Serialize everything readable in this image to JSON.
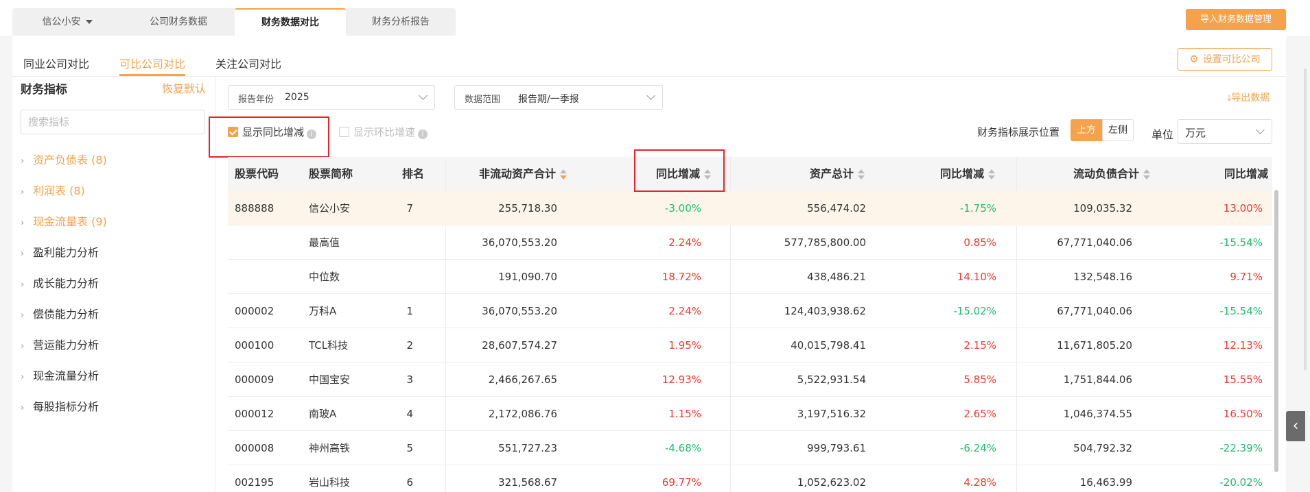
{
  "top_tabs": [
    {
      "label": "信公小安"
    },
    {
      "label": "公司财务数据"
    },
    {
      "label": "财务数据对比"
    },
    {
      "label": "财务分析报告"
    }
  ],
  "import_button": "导入财务数据管理",
  "sub_tabs": [
    {
      "label": "同业公司对比"
    },
    {
      "label": "可比公司对比"
    },
    {
      "label": "关注公司对比"
    }
  ],
  "set_button": "设置可比公司",
  "left_panel": {
    "title": "财务指标",
    "reset": "恢复默认",
    "search_placeholder": "搜索指标",
    "items": [
      {
        "label": "资产负债表 (8)"
      },
      {
        "label": "利润表 (8)"
      },
      {
        "label": "现金流量表 (9)"
      },
      {
        "label": "盈利能力分析"
      },
      {
        "label": "成长能力分析"
      },
      {
        "label": "偿债能力分析"
      },
      {
        "label": "营运能力分析"
      },
      {
        "label": "现金流量分析"
      },
      {
        "label": "每股指标分析"
      }
    ]
  },
  "filters": {
    "year_label": "报告年份",
    "year_value": "2025",
    "range_label": "数据范围",
    "range_value": "报告期/一季报",
    "export": "导出数据",
    "show_yoy": "显示同比增减",
    "show_qoq": "显示环比增速",
    "position_label": "财务指标展示位置",
    "position_top": "上方",
    "position_left": "左侧",
    "unit_label": "单位",
    "unit_value": "万元"
  },
  "table": {
    "headers": [
      "股票代码",
      "股票简称",
      "排名",
      "非流动资产合计",
      "同比增减",
      "资产总计",
      "同比增减",
      "流动负债合计",
      "同比增减"
    ],
    "rows": [
      {
        "code": "888888",
        "name": "信公小安",
        "rank": "7",
        "nca": "255,718.30",
        "nca_yoy": "-3.00%",
        "ta": "556,474.02",
        "ta_yoy": "-1.75%",
        "cl": "109,035.32",
        "cl_yoy": "13.00%"
      },
      {
        "code": "",
        "name": "最高值",
        "rank": "",
        "nca": "36,070,553.20",
        "nca_yoy": "2.24%",
        "ta": "577,785,800.00",
        "ta_yoy": "0.85%",
        "cl": "67,771,040.06",
        "cl_yoy": "-15.54%"
      },
      {
        "code": "",
        "name": "中位数",
        "rank": "",
        "nca": "191,090.70",
        "nca_yoy": "18.72%",
        "ta": "438,486.21",
        "ta_yoy": "14.10%",
        "cl": "132,548.16",
        "cl_yoy": "9.71%"
      },
      {
        "code": "000002",
        "name": "万科A",
        "rank": "1",
        "nca": "36,070,553.20",
        "nca_yoy": "2.24%",
        "ta": "124,403,938.62",
        "ta_yoy": "-15.02%",
        "cl": "67,771,040.06",
        "cl_yoy": "-15.54%"
      },
      {
        "code": "000100",
        "name": "TCL科技",
        "rank": "2",
        "nca": "28,607,574.27",
        "nca_yoy": "1.95%",
        "ta": "40,015,798.41",
        "ta_yoy": "2.15%",
        "cl": "11,671,805.20",
        "cl_yoy": "12.13%"
      },
      {
        "code": "000009",
        "name": "中国宝安",
        "rank": "3",
        "nca": "2,466,267.65",
        "nca_yoy": "12.93%",
        "ta": "5,522,931.54",
        "ta_yoy": "5.85%",
        "cl": "1,751,844.06",
        "cl_yoy": "15.55%"
      },
      {
        "code": "000012",
        "name": "南玻A",
        "rank": "4",
        "nca": "2,172,086.76",
        "nca_yoy": "1.15%",
        "ta": "3,197,516.32",
        "ta_yoy": "2.65%",
        "cl": "1,046,374.55",
        "cl_yoy": "16.50%"
      },
      {
        "code": "000008",
        "name": "神州高铁",
        "rank": "5",
        "nca": "551,727.23",
        "nca_yoy": "-4.68%",
        "ta": "999,793.61",
        "ta_yoy": "-6.24%",
        "cl": "504,792.32",
        "cl_yoy": "-22.39%"
      },
      {
        "code": "002195",
        "name": "岩山科技",
        "rank": "6",
        "nca": "321,568.67",
        "nca_yoy": "69.77%",
        "ta": "1,052,623.02",
        "ta_yoy": "4.28%",
        "cl": "16,463.99",
        "cl_yoy": "-20.02%"
      }
    ]
  },
  "colors": {
    "accent": "#f5a24b",
    "positive": "#ee3b2e",
    "negative": "#19be6b",
    "highlight_box": "#e6242a"
  },
  "icons": {
    "gear": "gear-icon",
    "export": "download-icon",
    "collapse": "chevron-left-icon"
  }
}
